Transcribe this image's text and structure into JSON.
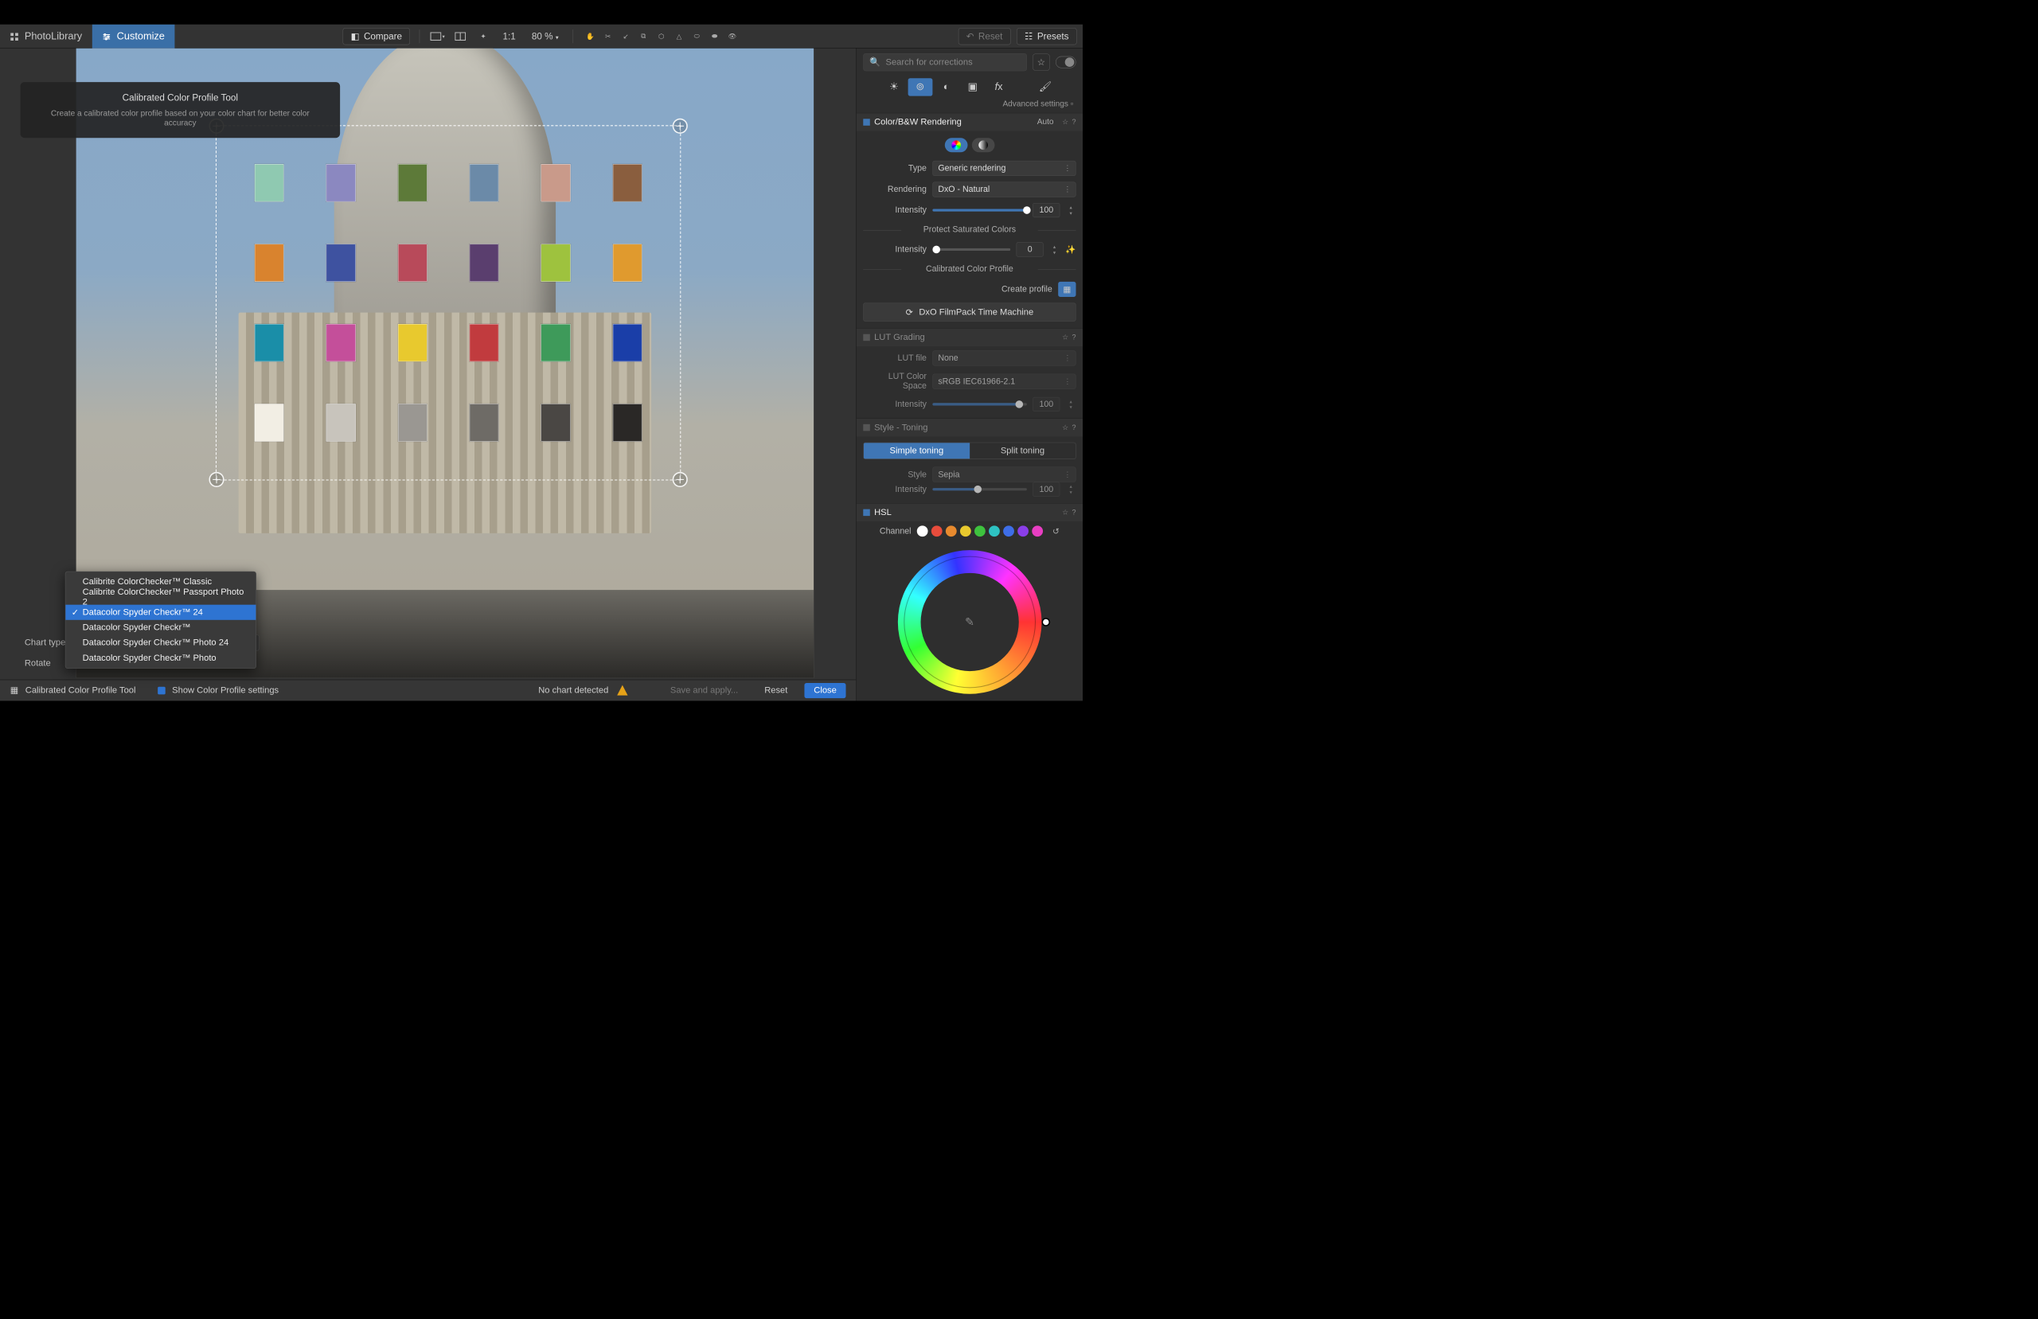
{
  "top": {
    "tab_library": "PhotoLibrary",
    "tab_customize": "Customize",
    "compare": "Compare",
    "ratio": "1:1",
    "zoom": "80 %",
    "reset": "Reset",
    "presets": "Presets"
  },
  "tooltip": {
    "title": "Calibrated Color Profile Tool",
    "desc": "Create a calibrated color profile based on your color chart for better color accuracy"
  },
  "chart_popup": {
    "items": [
      "Calibrite ColorChecker™ Classic",
      "Calibrite ColorChecker™ Passport Photo 2",
      "Datacolor Spyder Checkr™ 24",
      "Datacolor Spyder Checkr™",
      "Datacolor Spyder Checkr™ Photo 24",
      "Datacolor Spyder Checkr™ Photo"
    ],
    "selected_index": 2
  },
  "bottom_opts": {
    "chart_type": "Chart type",
    "rotate": "Rotate"
  },
  "status": {
    "tool": "Calibrated Color Profile Tool",
    "show_settings": "Show Color Profile settings",
    "no_chart": "No chart detected",
    "save": "Save and apply...",
    "reset": "Reset",
    "close": "Close"
  },
  "panel": {
    "search_ph": "Search for corrections",
    "advanced": "Advanced settings",
    "s_colorbw": "Color/B&W Rendering",
    "auto": "Auto",
    "type_l": "Type",
    "type_v": "Generic rendering",
    "rend_l": "Rendering",
    "rend_v": "DxO - Natural",
    "intensity_l": "Intensity",
    "intensity_v": "100",
    "protect": "Protect Saturated Colors",
    "prot_int_v": "0",
    "calib": "Calibrated Color Profile",
    "create_l": "Create profile",
    "filmpack": "DxO FilmPack Time Machine",
    "s_lut": "LUT Grading",
    "lut_file_l": "LUT file",
    "lut_file_v": "None",
    "lut_cs_l": "LUT Color Space",
    "lut_cs_v": "sRGB IEC61966-2.1",
    "lut_int_v": "100",
    "s_style": "Style - Toning",
    "simple": "Simple toning",
    "split": "Split toning",
    "style_l": "Style",
    "style_v": "Sepia",
    "style_int_v": "100",
    "s_hsl": "HSL",
    "channel_l": "Channel"
  },
  "patches": [
    "#8fc9b1",
    "#8b88c0",
    "#5d7a39",
    "#6b8aa8",
    "#c99a8a",
    "#8a5e3e",
    "#d9832e",
    "#3e52a0",
    "#b84a5a",
    "#5a3e6e",
    "#9ec23e",
    "#e09a2e",
    "#1a8ea8",
    "#c44f9a",
    "#e8c92e",
    "#c13b3e",
    "#3e9a5a",
    "#1a3ea8",
    "#f2eee4",
    "#c8c4bc",
    "#9a9792",
    "#6e6b66",
    "#4a4744",
    "#2a2826"
  ],
  "hsl_dots": [
    "#ffffff",
    "#e84c3c",
    "#e88a2e",
    "#e8c92e",
    "#3ec23e",
    "#2ec2c2",
    "#3e6ee8",
    "#8a3ee8",
    "#e83ec2"
  ]
}
